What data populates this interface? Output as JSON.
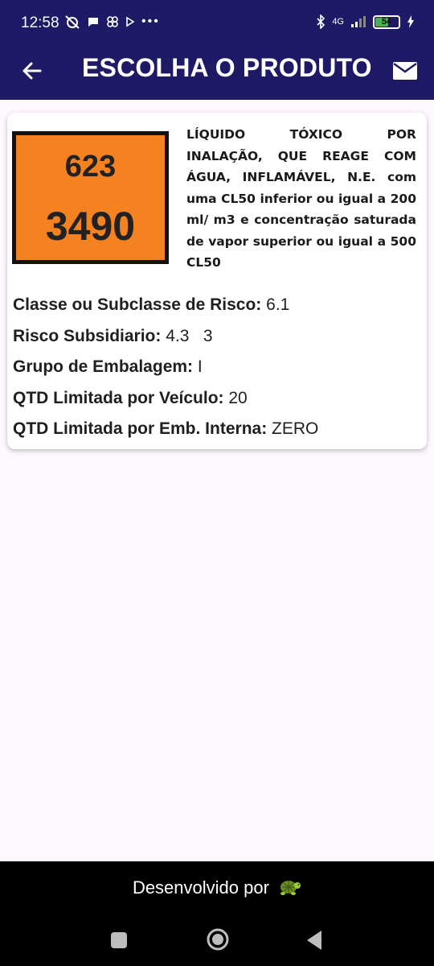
{
  "status_bar": {
    "time": "12:58",
    "network": "4G",
    "battery_level": 54,
    "battery_label": "54"
  },
  "app_bar": {
    "title": "ESCOLHA O PRODUTO"
  },
  "product": {
    "hazard_number": "623",
    "un_number": "3490",
    "description": "LÍQUIDO TÓXICO POR INALAÇÃO, QUE REAGE COM ÁGUA, INFLAMÁVEL, N.E. com uma CL50 inferior ou igual a 200 ml/ m3 e concentração saturada de vapor superior ou igual a 500 CL50",
    "placard_color": "#f58220",
    "details": [
      {
        "label": "Classe ou Subclasse de Risco:",
        "value": "6.1"
      },
      {
        "label": "Risco Subsidiario:",
        "value": "4.3   3"
      },
      {
        "label": "Grupo de Embalagem:",
        "value": "I"
      },
      {
        "label": "QTD Limitada por Veículo:",
        "value": "20"
      },
      {
        "label": "QTD Limitada por Emb. Interna:",
        "value": "ZERO"
      }
    ]
  },
  "footer": {
    "text": "Desenvolvido por",
    "logo_icon": "turtle-icon"
  },
  "colors": {
    "app_bar": "#1f1a66",
    "background": "#fdf7fe"
  }
}
